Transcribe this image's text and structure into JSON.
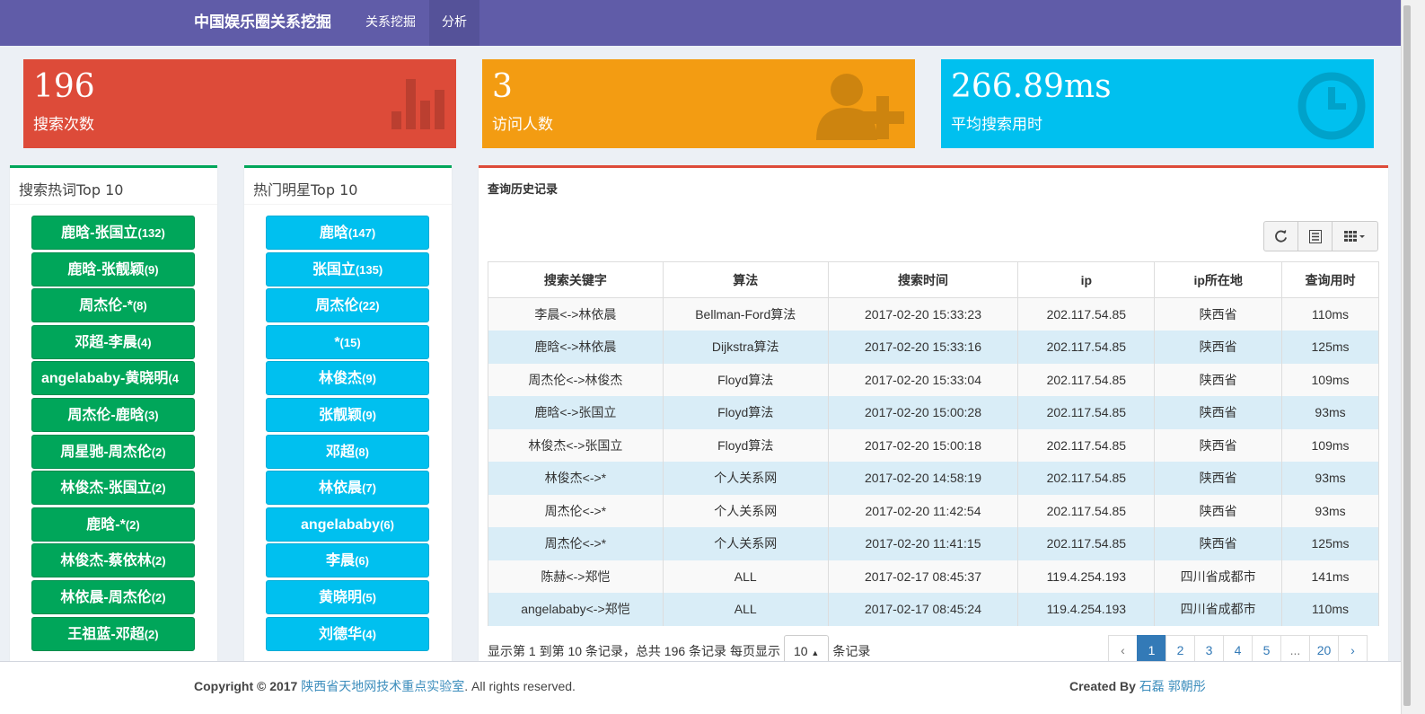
{
  "navbar": {
    "brand": "中国娱乐圈关系挖掘",
    "items": [
      "关系挖掘",
      "分析"
    ],
    "active": "分析"
  },
  "stats": [
    {
      "value": "196",
      "label": "搜索次数",
      "color": "#dd4b39",
      "icon": "bar-chart-icon"
    },
    {
      "value": "3",
      "label": "访问人数",
      "color": "#f39c12",
      "icon": "user-plus-icon"
    },
    {
      "value": "266.89ms",
      "label": "平均搜索用时",
      "color": "#00c0ef",
      "icon": "clock-icon"
    }
  ],
  "hot_keywords": {
    "title": "搜索热词Top 10",
    "items": [
      {
        "label": "鹿晗-张国立",
        "count": "(132)"
      },
      {
        "label": "鹿晗-张靓颖",
        "count": "(9)"
      },
      {
        "label": "周杰伦-*",
        "count": "(8)"
      },
      {
        "label": "邓超-李晨",
        "count": "(4)"
      },
      {
        "label": "angelababy-黄晓明",
        "count": "(4"
      },
      {
        "label": "周杰伦-鹿晗",
        "count": "(3)"
      },
      {
        "label": "周星驰-周杰伦",
        "count": "(2)"
      },
      {
        "label": "林俊杰-张国立",
        "count": "(2)"
      },
      {
        "label": "鹿晗-*",
        "count": "(2)"
      },
      {
        "label": "林俊杰-蔡依林",
        "count": "(2)"
      },
      {
        "label": "林依晨-周杰伦",
        "count": "(2)"
      },
      {
        "label": "王祖蓝-邓超",
        "count": "(2)"
      }
    ]
  },
  "hot_stars": {
    "title": "热门明星Top 10",
    "items": [
      {
        "label": "鹿晗",
        "count": "(147)"
      },
      {
        "label": "张国立",
        "count": "(135)"
      },
      {
        "label": "周杰伦",
        "count": "(22)"
      },
      {
        "label": "*",
        "count": "(15)"
      },
      {
        "label": "林俊杰",
        "count": "(9)"
      },
      {
        "label": "张靓颖",
        "count": "(9)"
      },
      {
        "label": "邓超",
        "count": "(8)"
      },
      {
        "label": "林依晨",
        "count": "(7)"
      },
      {
        "label": "angelababy",
        "count": "(6)"
      },
      {
        "label": "李晨",
        "count": "(6)"
      },
      {
        "label": "黄晓明",
        "count": "(5)"
      },
      {
        "label": "刘德华",
        "count": "(4)"
      }
    ]
  },
  "history": {
    "title": "查询历史记录",
    "columns": [
      "搜索关键字",
      "算法",
      "搜索时间",
      "ip",
      "ip所在地",
      "查询用时"
    ],
    "rows": [
      [
        "李晨<->林依晨",
        "Bellman-Ford算法",
        "2017-02-20 15:33:23",
        "202.117.54.85",
        "陕西省",
        "110ms"
      ],
      [
        "鹿晗<->林依晨",
        "Dijkstra算法",
        "2017-02-20 15:33:16",
        "202.117.54.85",
        "陕西省",
        "125ms"
      ],
      [
        "周杰伦<->林俊杰",
        "Floyd算法",
        "2017-02-20 15:33:04",
        "202.117.54.85",
        "陕西省",
        "109ms"
      ],
      [
        "鹿晗<->张国立",
        "Floyd算法",
        "2017-02-20 15:00:28",
        "202.117.54.85",
        "陕西省",
        "93ms"
      ],
      [
        "林俊杰<->张国立",
        "Floyd算法",
        "2017-02-20 15:00:18",
        "202.117.54.85",
        "陕西省",
        "109ms"
      ],
      [
        "林俊杰<->*",
        "个人关系网",
        "2017-02-20 14:58:19",
        "202.117.54.85",
        "陕西省",
        "93ms"
      ],
      [
        "周杰伦<->*",
        "个人关系网",
        "2017-02-20 11:42:54",
        "202.117.54.85",
        "陕西省",
        "93ms"
      ],
      [
        "周杰伦<->*",
        "个人关系网",
        "2017-02-20 11:41:15",
        "202.117.54.85",
        "陕西省",
        "125ms"
      ],
      [
        "陈赫<->郑恺",
        "ALL",
        "2017-02-17 08:45:37",
        "119.4.254.193",
        "四川省成都市",
        "141ms"
      ],
      [
        "angelababy<->郑恺",
        "ALL",
        "2017-02-17 08:45:24",
        "119.4.254.193",
        "四川省成都市",
        "110ms"
      ]
    ],
    "pagination_info_prefix": "显示第 1 到第 10 条记录，总共 196 条记录 每页显示",
    "page_size": "10",
    "pagination_info_suffix": "条记录",
    "pages": [
      "‹",
      "1",
      "2",
      "3",
      "4",
      "5",
      "...",
      "20",
      "›"
    ],
    "active_page": "1"
  },
  "footer": {
    "copyright_prefix": "Copyright © 2017",
    "org": "陕西省天地网技术重点实验室",
    "rights": ". All rights reserved.",
    "created_label": "Created By",
    "authors": "石磊 郭朝彤"
  }
}
